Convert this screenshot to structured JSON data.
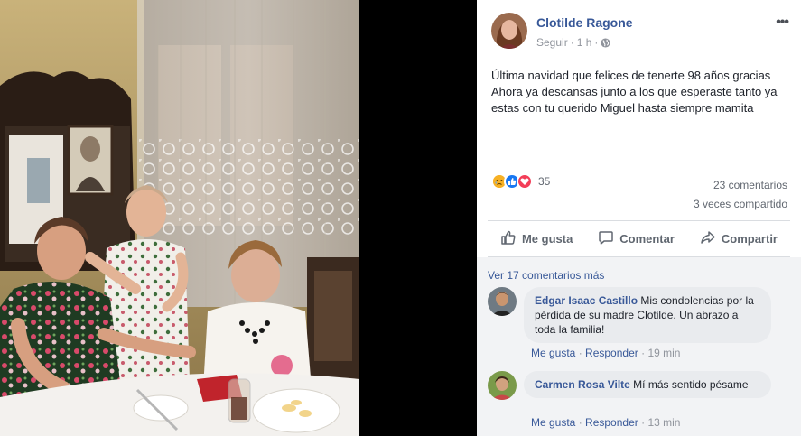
{
  "post": {
    "author": "Clotilde Ragone",
    "follow": "Seguir",
    "time": "1 h",
    "separator": "·",
    "more": "•••",
    "text": "Última navidad que felices de tenerte 98 años gracias Ahora ya descansas junto a los que esperaste tanto ya estas con tu querido Miguel hasta siempre mamita",
    "reaction_count": "35",
    "comments_count": "23 comentarios",
    "shares_count": "3 veces compartido",
    "reactions": [
      "sad-icon",
      "like-icon",
      "love-icon"
    ]
  },
  "actions": {
    "like": "Me gusta",
    "comment": "Comentar",
    "share": "Compartir"
  },
  "comments": {
    "view_more": "Ver 17 comentarios más",
    "items": [
      {
        "name": "Edgar Isaac Castillo",
        "text": "Mis condolencias por la pérdida de su madre Clotilde. Un abrazo a toda la familia!",
        "like": "Me gusta",
        "reply": "Responder",
        "time": "19 min"
      },
      {
        "name": "Carmen Rosa Vilte",
        "text": "Mí más sentido pésame",
        "like": "Me gusta",
        "reply": "Responder",
        "time": "13 min"
      }
    ]
  },
  "colors": {
    "link": "#385898",
    "text": "#1d2129",
    "muted": "#90949c",
    "like_blue": "#1877f2",
    "love_red": "#f33e58",
    "sad_yellow": "#f7b125"
  }
}
